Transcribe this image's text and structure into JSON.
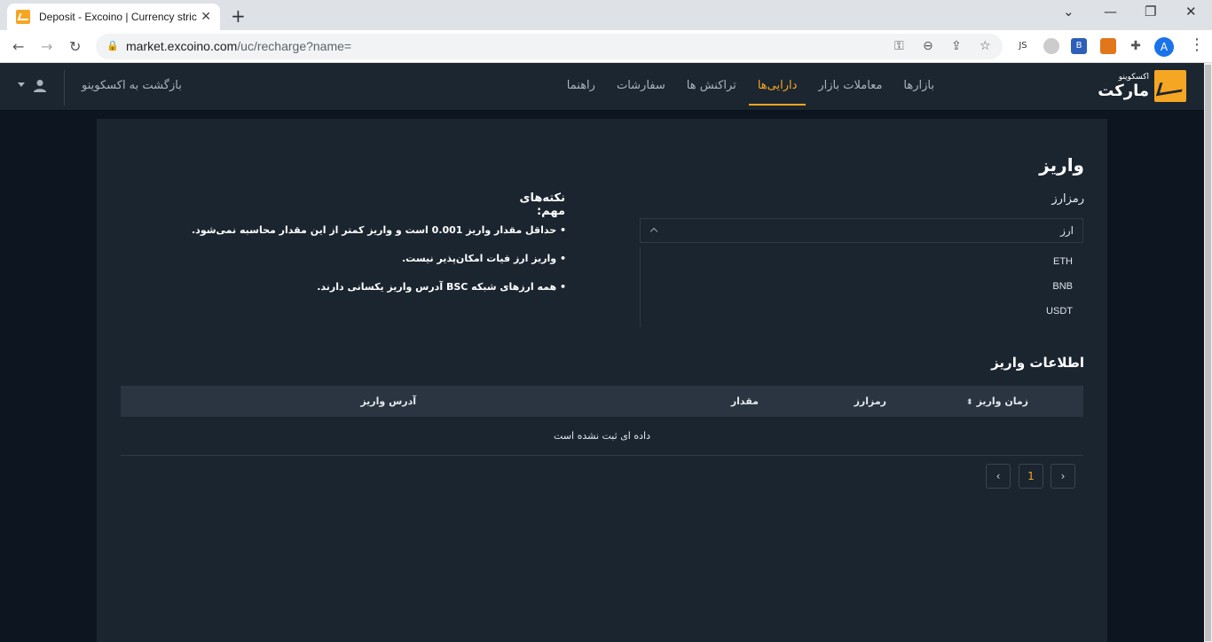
{
  "browser": {
    "tab_title": "Deposit - Excoino | Currency stric",
    "url_host": "market.excoino.com",
    "url_path": "/uc/recharge?name=",
    "avatar_letter": "A"
  },
  "header": {
    "logo_small": "اکسکوینو",
    "logo_big": "مارکت",
    "nav": [
      {
        "label": "بازارها",
        "active": false
      },
      {
        "label": "معاملات بازار",
        "active": false
      },
      {
        "label": "دارایی‌ها",
        "active": true
      },
      {
        "label": "تراکنش ها",
        "active": false
      },
      {
        "label": "سفارشات",
        "active": false
      },
      {
        "label": "راهنما",
        "active": false
      }
    ],
    "back_link": "بازگشت به اکسکوینو"
  },
  "deposit": {
    "title": "واریز",
    "currency_label": "رمزارز",
    "select_placeholder": "ارز",
    "options": [
      "ETH",
      "BNB",
      "USDT"
    ],
    "notes_title": "نکته‌های مهم:",
    "notes": [
      "• حداقل مقدار واریز 0.001 است و واریز کمتر از این مقدار محاسبه نمی‌شود.",
      "• واریز ارز فیات امکان‌پذیر نیست.",
      "• همه ارزهای شبکه BSC آدرس واریز یکسانی دارند."
    ],
    "info_title": "اطلاعات واریز",
    "columns": [
      "زمان واریز",
      "رمزارز",
      "مقدار",
      "آدرس واریز"
    ],
    "empty_text": "داده ای ثبت نشده است",
    "pagination": {
      "current": "1",
      "prev": "‹",
      "next": "›"
    }
  },
  "colors": {
    "accent": "#f5a623",
    "bg": "#0d1620",
    "panel": "#1b2530",
    "header": "#1c2630"
  }
}
